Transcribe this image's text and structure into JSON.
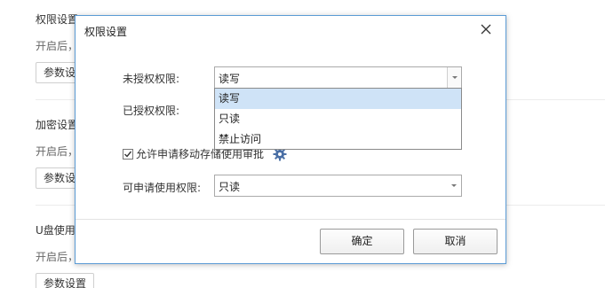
{
  "background": {
    "sections": [
      {
        "title": "权限设置",
        "desc": "开启后，",
        "button": "参数设置"
      },
      {
        "title": "加密设置",
        "desc": "开启后，",
        "button": "参数设置"
      },
      {
        "title": "U盘使用",
        "desc": "开启后，",
        "button": "参数设置"
      }
    ]
  },
  "dialog": {
    "title": "权限设置",
    "close_icon": "close-icon",
    "unauthorized_label": "未授权权限:",
    "unauthorized_value": "读写",
    "authorized_label": "已授权权限:",
    "dropdown_options": [
      "读写",
      "只读",
      "禁止访问"
    ],
    "dropdown_selected_index": 0,
    "allow_request_checked": true,
    "allow_request_label": "允许申请移动存储使用审批",
    "settings_icon": "gear-icon",
    "requestable_label": "可申请使用权限:",
    "requestable_value": "只读",
    "ok_label": "确定",
    "cancel_label": "取消"
  }
}
